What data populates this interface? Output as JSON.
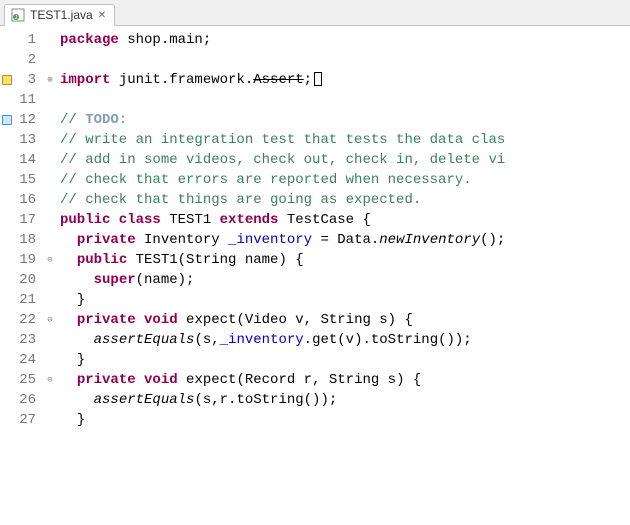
{
  "tab": {
    "filename": "TEST1.java",
    "close_glyph": "✕"
  },
  "lines": [
    {
      "n": 1,
      "marker": "",
      "fold": "",
      "tokens": [
        [
          "kw",
          "package"
        ],
        [
          "",
          " shop.main;"
        ]
      ]
    },
    {
      "n": 2,
      "marker": "",
      "fold": "",
      "tokens": []
    },
    {
      "n": 3,
      "marker": "warn",
      "fold": "⊕",
      "tokens": [
        [
          "kw",
          "import"
        ],
        [
          "",
          " junit.framework."
        ],
        [
          "deprecated",
          "Assert"
        ],
        [
          "",
          ";"
        ],
        [
          "cursor",
          ""
        ]
      ]
    },
    {
      "n": 11,
      "marker": "",
      "fold": "",
      "tokens": []
    },
    {
      "n": 12,
      "marker": "quick",
      "fold": "",
      "tokens": [
        [
          "comment",
          "// "
        ],
        [
          "task",
          "TODO:"
        ]
      ]
    },
    {
      "n": 13,
      "marker": "",
      "fold": "",
      "tokens": [
        [
          "comment",
          "// write an integration test that tests the data clas"
        ]
      ]
    },
    {
      "n": 14,
      "marker": "",
      "fold": "",
      "tokens": [
        [
          "comment",
          "// add in some videos, check out, check in, delete vi"
        ]
      ]
    },
    {
      "n": 15,
      "marker": "",
      "fold": "",
      "tokens": [
        [
          "comment",
          "// check that errors are reported when necessary."
        ]
      ]
    },
    {
      "n": 16,
      "marker": "",
      "fold": "",
      "tokens": [
        [
          "comment",
          "// check that things are going as expected."
        ]
      ]
    },
    {
      "n": 17,
      "marker": "",
      "fold": "",
      "tokens": [
        [
          "kw",
          "public class"
        ],
        [
          "",
          " TEST1 "
        ],
        [
          "kw",
          "extends"
        ],
        [
          "",
          " TestCase {"
        ]
      ]
    },
    {
      "n": 18,
      "marker": "",
      "fold": "",
      "tokens": [
        [
          "",
          "  "
        ],
        [
          "kw",
          "private"
        ],
        [
          "",
          " Inventory "
        ],
        [
          "field",
          "_inventory"
        ],
        [
          "",
          " = Data."
        ],
        [
          "method-static",
          "newInventory"
        ],
        [
          "",
          "();"
        ]
      ]
    },
    {
      "n": 19,
      "marker": "",
      "fold": "⊖",
      "tokens": [
        [
          "",
          "  "
        ],
        [
          "kw",
          "public"
        ],
        [
          "",
          " TEST1(String name) {"
        ]
      ]
    },
    {
      "n": 20,
      "marker": "",
      "fold": "",
      "tokens": [
        [
          "",
          "    "
        ],
        [
          "kw",
          "super"
        ],
        [
          "",
          "(name);"
        ]
      ]
    },
    {
      "n": 21,
      "marker": "",
      "fold": "",
      "tokens": [
        [
          "",
          "  }"
        ]
      ]
    },
    {
      "n": 22,
      "marker": "",
      "fold": "⊖",
      "tokens": [
        [
          "",
          "  "
        ],
        [
          "kw",
          "private void"
        ],
        [
          "",
          " expect(Video v, String s) {"
        ]
      ]
    },
    {
      "n": 23,
      "marker": "",
      "fold": "",
      "tokens": [
        [
          "",
          "    "
        ],
        [
          "method-static",
          "assertEquals"
        ],
        [
          "",
          "(s,"
        ],
        [
          "field",
          "_inventory"
        ],
        [
          "",
          ".get(v).toString());"
        ]
      ]
    },
    {
      "n": 24,
      "marker": "",
      "fold": "",
      "tokens": [
        [
          "",
          "  }"
        ]
      ]
    },
    {
      "n": 25,
      "marker": "",
      "fold": "⊖",
      "tokens": [
        [
          "",
          "  "
        ],
        [
          "kw",
          "private void"
        ],
        [
          "",
          " expect(Record r, String s) {"
        ]
      ]
    },
    {
      "n": 26,
      "marker": "",
      "fold": "",
      "tokens": [
        [
          "",
          "    "
        ],
        [
          "method-static",
          "assertEquals"
        ],
        [
          "",
          "(s,r.toString());"
        ]
      ]
    },
    {
      "n": 27,
      "marker": "",
      "fold": "",
      "tokens": [
        [
          "",
          "  }"
        ]
      ]
    }
  ]
}
